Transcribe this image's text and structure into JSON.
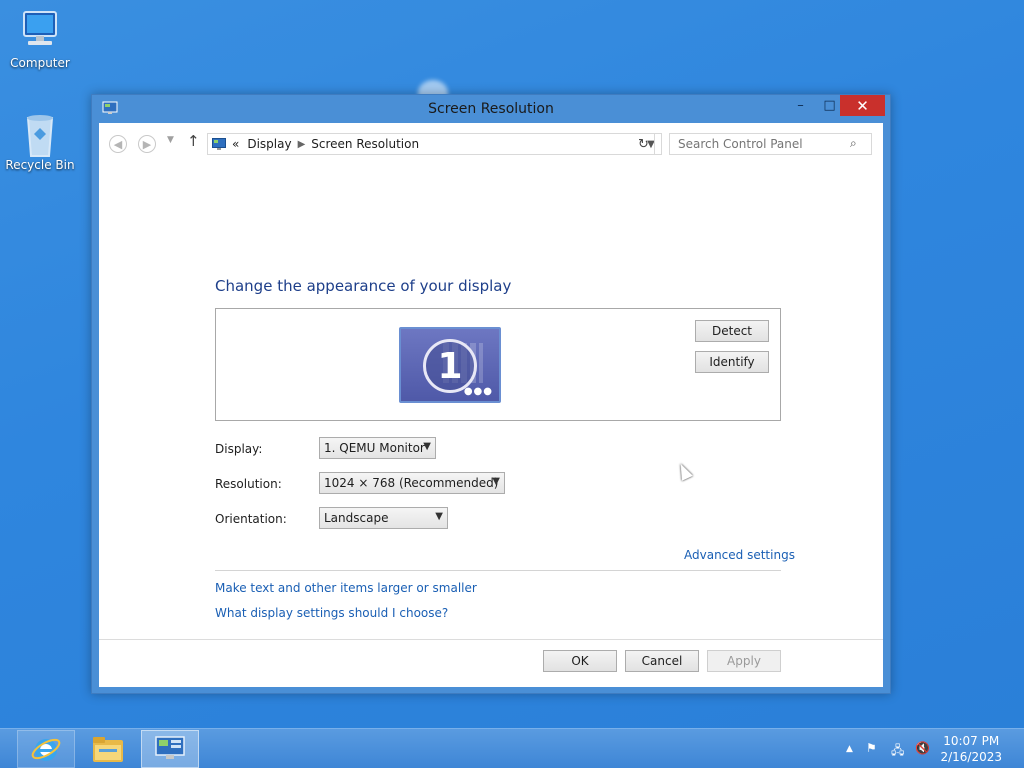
{
  "desktop": {
    "icons": [
      {
        "label": "Computer"
      },
      {
        "label": "Recycle Bin"
      }
    ]
  },
  "window": {
    "title": "Screen Resolution",
    "controls": {
      "minimize": "–",
      "maximize": "□",
      "close": "✕"
    }
  },
  "address_bar": {
    "breadcrumbs": [
      "«",
      "Display",
      "Screen Resolution"
    ],
    "search_placeholder": "Search Control Panel"
  },
  "content": {
    "heading": "Change the appearance of your display",
    "monitor_number": "1",
    "detect_label": "Detect",
    "identify_label": "Identify",
    "display_label": "Display:",
    "display_value": "1. QEMU Monitor",
    "resolution_label": "Resolution:",
    "resolution_value": "1024 × 768 (Recommended)",
    "orientation_label": "Orientation:",
    "orientation_value": "Landscape",
    "advanced_link": "Advanced settings",
    "link_text_size": "Make text and other items larger or smaller",
    "link_which_settings": "What display settings should I choose?"
  },
  "footer": {
    "ok_label": "OK",
    "cancel_label": "Cancel",
    "apply_label": "Apply"
  },
  "taskbar": {
    "time": "10:07 PM",
    "date": "2/16/2023"
  },
  "colors": {
    "desktop": "#2f86de",
    "link": "#1a5fb4",
    "heading": "#1e3f8a",
    "close_button": "#c9302c"
  }
}
